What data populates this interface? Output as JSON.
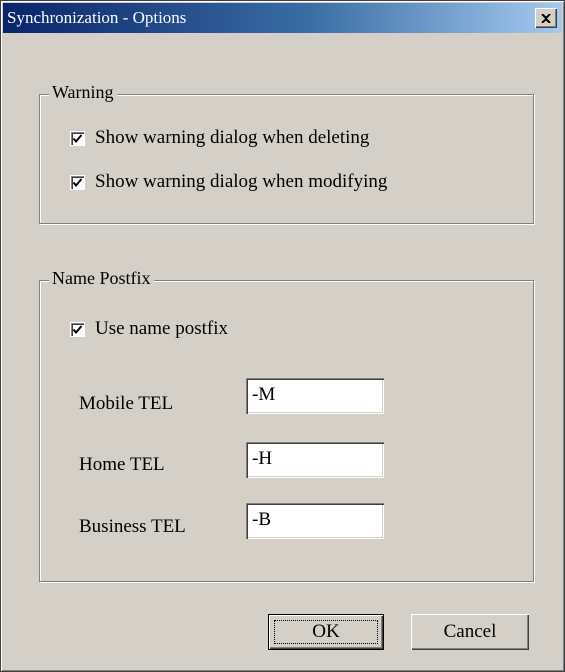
{
  "window": {
    "title": "Synchronization - Options",
    "close_icon": "close-icon"
  },
  "warning_group": {
    "legend": "Warning",
    "options": [
      {
        "label": "Show warning dialog when deleting",
        "checked": true
      },
      {
        "label": "Show warning dialog when modifying",
        "checked": true
      }
    ]
  },
  "postfix_group": {
    "legend": "Name Postfix",
    "use_postfix": {
      "label": "Use name postfix",
      "checked": true
    },
    "fields": [
      {
        "label": "Mobile TEL",
        "value": "-M"
      },
      {
        "label": "Home TEL",
        "value": "-H"
      },
      {
        "label": "Business TEL",
        "value": "-B"
      }
    ]
  },
  "buttons": {
    "ok": "OK",
    "cancel": "Cancel"
  }
}
